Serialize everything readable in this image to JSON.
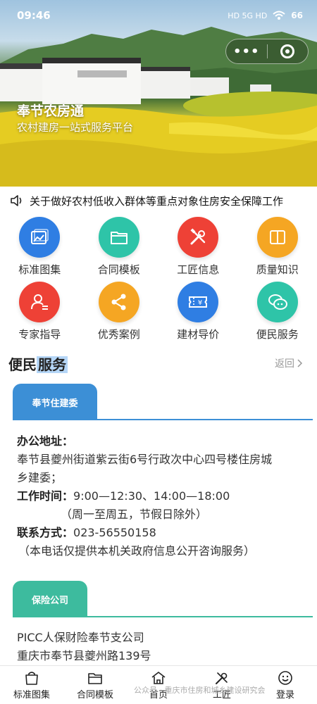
{
  "status_bar": {
    "time": "09:46",
    "battery": "66",
    "signal_text": "HD 5G HD"
  },
  "capsule": {
    "more_icon": "more-dots-icon",
    "close_icon": "target-ring-icon"
  },
  "hero": {
    "title": "奉节农房通",
    "subtitle": "农村建房一站式服务平台"
  },
  "notice": {
    "icon": "speaker-icon",
    "text": "关于做好农村低收入群体等重点对象住房安全保障工作"
  },
  "grid": {
    "items": [
      {
        "label": "标准图集",
        "icon": "image-gallery-icon",
        "color": "#2f7ee3"
      },
      {
        "label": "合同模板",
        "icon": "folder-icon",
        "color": "#2ec4a8"
      },
      {
        "label": "工匠信息",
        "icon": "tools-icon",
        "color": "#ee4136"
      },
      {
        "label": "质量知识",
        "icon": "book-icon",
        "color": "#f5a623"
      },
      {
        "label": "专家指导",
        "icon": "expert-icon",
        "color": "#ee4136"
      },
      {
        "label": "优秀案例",
        "icon": "share-icon",
        "color": "#f5a623"
      },
      {
        "label": "建材导价",
        "icon": "ticket-yuan-icon",
        "color": "#2f7ee3"
      },
      {
        "label": "便民服务",
        "icon": "chat-icon",
        "color": "#2ec4a8"
      }
    ]
  },
  "section": {
    "title_a": "便民",
    "title_b": "服务",
    "back_label": "返回"
  },
  "card1": {
    "tab": "奉节住建委",
    "address_label": "办公地址：",
    "address_line1": "奉节县夔州街道紫云街6号行政次中心四号楼住房城",
    "address_line2": "乡建委；",
    "hours_label": "工作时间：",
    "hours_value": "9:00—12:30、14:00—18:00",
    "hours_note": "（周一至周五，节假日除外）",
    "contact_label": "联系方式：",
    "contact_value": "023-56550158",
    "contact_note": "（本电话仅提供本机关政府信息公开咨询服务）"
  },
  "card2": {
    "tab": "保险公司",
    "line1": "PICC人保财险奉节支公司",
    "line2": "重庆市奉节县夔州路139号"
  },
  "tabbar": {
    "items": [
      {
        "label": "标准图集",
        "icon": "bag-icon"
      },
      {
        "label": "合同模板",
        "icon": "folder-outline-icon"
      },
      {
        "label": "首页",
        "icon": "home-icon"
      },
      {
        "label": "工匠",
        "icon": "tools-outline-icon"
      },
      {
        "label": "登录",
        "icon": "smile-icon"
      }
    ]
  },
  "watermark": "公众号 · 重庆市住房和城乡建设研究会"
}
